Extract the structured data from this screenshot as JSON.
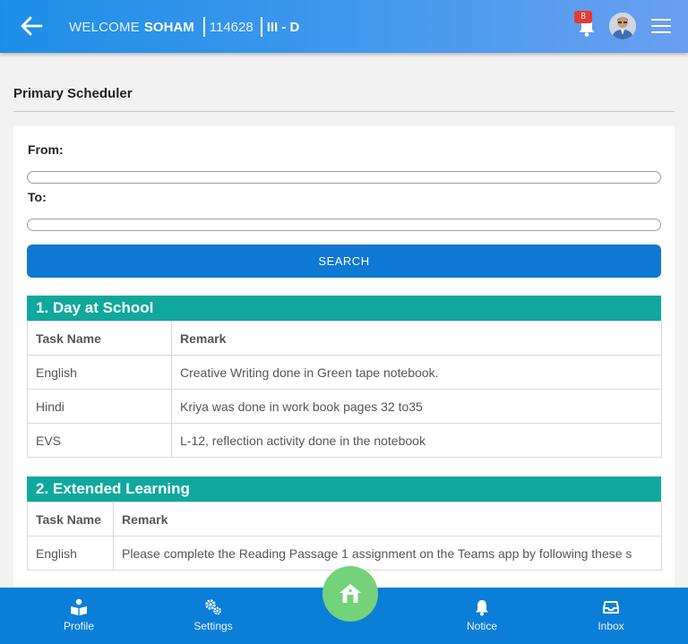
{
  "header": {
    "welcome_label": "WELCOME",
    "user_name": "SOHAM",
    "user_id": "114628",
    "class_section": "III - D",
    "notification_count": "8"
  },
  "page": {
    "title": "Primary Scheduler"
  },
  "form": {
    "from_label": "From:",
    "from_value": "",
    "to_label": "To:",
    "to_value": "",
    "search_label": "SEARCH"
  },
  "sections": [
    {
      "title": "1. Day at School",
      "headers": [
        "Task Name",
        "Remark"
      ],
      "rows": [
        [
          "English",
          "Creative Writing done in Green tape notebook."
        ],
        [
          "Hindi",
          "Kriya was done in work book pages 32 to35"
        ],
        [
          "EVS",
          "L-12, reflection activity done in the notebook"
        ]
      ]
    },
    {
      "title": "2. Extended Learning",
      "headers": [
        "Task Name",
        "Remark"
      ],
      "rows": [
        [
          "English",
          "Please complete the Reading Passage 1 assignment on the Teams app by following these s"
        ]
      ]
    }
  ],
  "nav": {
    "profile": "Profile",
    "settings": "Settings",
    "notice": "Notice",
    "inbox": "Inbox"
  },
  "colors": {
    "header_start": "#1d8ee6",
    "header_end": "#6a9ff0",
    "search_button": "#0f78d2",
    "section_header": "#10a89c",
    "bottom_nav": "#0b7ed8",
    "home_button": "#73d27a",
    "badge": "#e53935"
  },
  "icons": {
    "back": "arrow-left-icon",
    "bell": "bell-icon",
    "menu": "hamburger-icon",
    "profile": "reader-icon",
    "settings": "gears-icon",
    "home": "home-icon",
    "notice": "bell-icon",
    "inbox": "inbox-icon"
  }
}
